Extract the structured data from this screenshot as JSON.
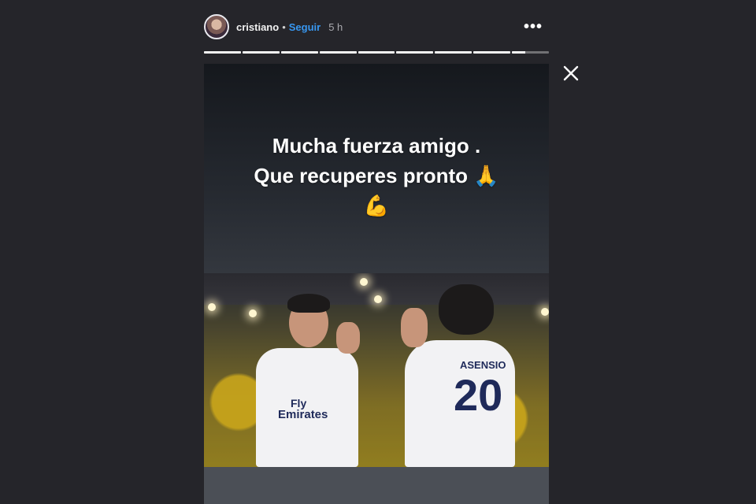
{
  "header": {
    "username": "cristiano",
    "separator": "•",
    "follow_label": "Seguir",
    "time": "5 h",
    "more_label": "•••"
  },
  "progress": {
    "segments": 9,
    "completed": 8,
    "current_fraction": 0.35
  },
  "story": {
    "caption_line1": "Mucha fuerza amigo .",
    "caption_line2": "Que recuperes pronto",
    "caption_emoji1": "🙏",
    "caption_emoji2": "💪",
    "jersey_name": "ASENSIO",
    "jersey_number": "20",
    "sponsor_line1": "Fly",
    "sponsor_line2": "Emirates"
  },
  "icons": {
    "close": "close-icon",
    "more": "more-icon",
    "avatar": "avatar"
  },
  "colors": {
    "background": "#25252a",
    "follow": "#3897f0",
    "text": "#ffffff"
  }
}
